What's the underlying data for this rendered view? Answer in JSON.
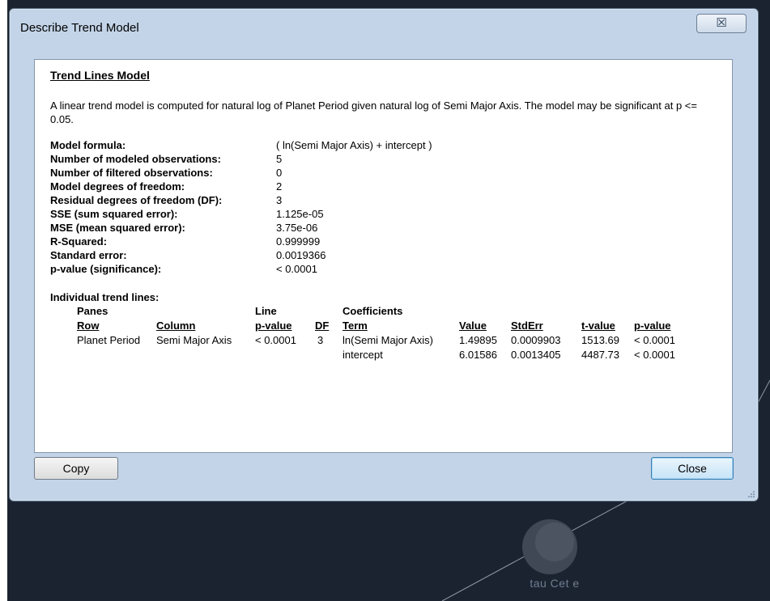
{
  "window": {
    "title": "Describe Trend Model",
    "close_glyph": "☒"
  },
  "report": {
    "heading": "Trend Lines Model",
    "description": "A linear trend model is computed for natural log of Planet Period given natural log of Semi Major Axis.  The model may be significant at p <= 0.05.",
    "stats": [
      {
        "label": "Model formula:",
        "value": "( ln(Semi Major Axis) + intercept )"
      },
      {
        "label": "Number of modeled observations:",
        "value": "5"
      },
      {
        "label": "Number of filtered observations:",
        "value": "0"
      },
      {
        "label": "Model degrees of freedom:",
        "value": "2"
      },
      {
        "label": "Residual degrees of freedom (DF):",
        "value": "3"
      },
      {
        "label": "SSE (sum squared error):",
        "value": "1.125e-05"
      },
      {
        "label": "MSE (mean squared error):",
        "value": "3.75e-06"
      },
      {
        "label": "R-Squared:",
        "value": "0.999999"
      },
      {
        "label": "Standard error:",
        "value": "0.0019366"
      },
      {
        "label": "p-value (significance):",
        "value": "< 0.0001"
      }
    ],
    "individual_heading": "Individual trend lines:",
    "group_headers": {
      "panes": "Panes",
      "line": "Line",
      "coefficients": "Coefficients"
    },
    "columns": {
      "row": "Row",
      "column": "Column",
      "line_pvalue": "p-value",
      "df": "DF",
      "term": "Term",
      "value": "Value",
      "stderr": "StdErr",
      "tvalue": "t-value",
      "pvalue": "p-value"
    },
    "rows": [
      {
        "row": "Planet Period",
        "column": "Semi Major Axis",
        "line_pvalue": "< 0.0001",
        "df": "3",
        "term": "ln(Semi Major Axis)",
        "value": "1.49895",
        "stderr": "0.0009903",
        "tvalue": "1513.69",
        "pvalue": "< 0.0001"
      },
      {
        "row": "",
        "column": "",
        "line_pvalue": "",
        "df": "",
        "term": "intercept",
        "value": "6.01586",
        "stderr": "0.0013405",
        "tvalue": "4487.73",
        "pvalue": "< 0.0001"
      }
    ]
  },
  "buttons": {
    "copy": "Copy",
    "close": "Close"
  },
  "background": {
    "planet_label": "tau Cet e"
  },
  "colors": {
    "backdrop": "#1b2331",
    "dialog_frame": "#c3d4e8"
  }
}
